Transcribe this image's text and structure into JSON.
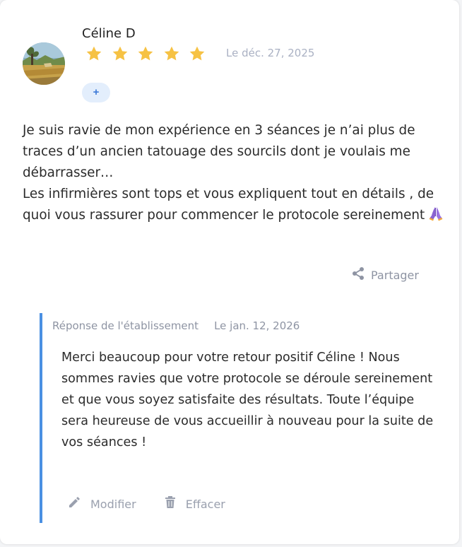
{
  "review": {
    "author": "Céline D",
    "rating": 5,
    "rating_max": 5,
    "date": "Le déc. 27, 2025",
    "expand_label": "+",
    "text_lines": [
      "Je suis ravie de mon expérience en 3 séances je n’ai plus de traces d’un ancien tatouage des sourcils dont je voulais me débarrasser…",
      "Les infirmières sont tops et vous expliquent tout en détails , de quoi vous rassurer pour commencer le protocole sereinement"
    ],
    "emoji": "folded-hands-emoji",
    "share_label": "Partager"
  },
  "reply": {
    "title": "Réponse de l'établissement",
    "date": "Le jan. 12, 2026",
    "text": "Merci beaucoup pour votre retour positif Céline ! Nous sommes ravies que votre protocole se déroule sereinement et que vous soyez satisfaite des résultats. Toute l’équipe sera heureuse de vous accueillir à nouveau pour la suite de vos séances !",
    "edit_label": "Modifier",
    "delete_label": "Effacer"
  },
  "colors": {
    "star": "#f6c244",
    "accent": "#4a90e2",
    "muted": "#8e94a3",
    "badge_bg": "#e3eefc"
  },
  "icons": [
    "star-icon",
    "plus-icon",
    "share-icon",
    "pencil-icon",
    "trash-icon"
  ]
}
